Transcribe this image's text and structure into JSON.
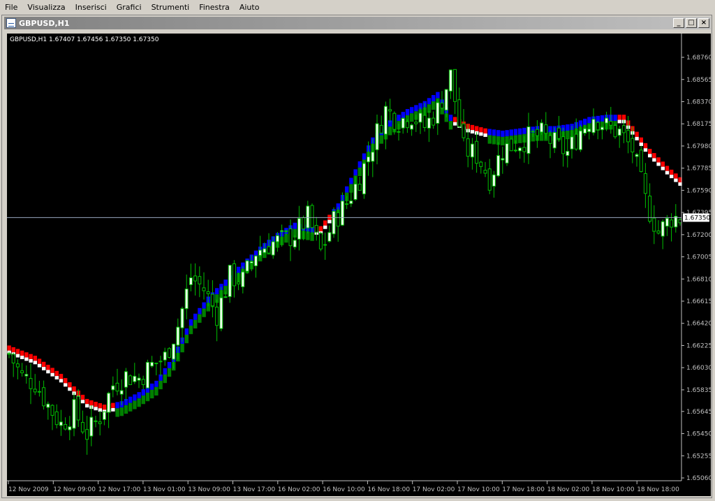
{
  "menu": [
    {
      "label": "File"
    },
    {
      "label": "Visualizza"
    },
    {
      "label": "Inserisci"
    },
    {
      "label": "Grafici"
    },
    {
      "label": "Strumenti"
    },
    {
      "label": "Finestra"
    },
    {
      "label": "Aiuto"
    }
  ],
  "window": {
    "title": "GBPUSD,H1",
    "minimize_glyph": "_",
    "maximize_glyph": "□",
    "close_glyph": "×"
  },
  "chart_info": "GBPUSD,H1  1.67407  1.67456  1.67350  1.67350",
  "colors": {
    "background": "#000000",
    "candle": "#00c000",
    "bull_body": "#eaffea",
    "bear_body": "#000000",
    "band_up": "#0000ff",
    "band_down": "#ff0000",
    "band_upper_edge": "#ffffff",
    "band_lower": "#008000",
    "price_line": "#9aa8c0"
  },
  "chart_data": {
    "type": "candlestick",
    "symbol": "GBPUSD",
    "timeframe": "H1",
    "current_price": "1.67350",
    "ylim": [
      1.6506,
      1.6892
    ],
    "y_ticks": [
      "1.68760",
      "1.68565",
      "1.68370",
      "1.68175",
      "1.67980",
      "1.67785",
      "1.67590",
      "1.67395",
      "1.67200",
      "1.67005",
      "1.66810",
      "1.66615",
      "1.66420",
      "1.66225",
      "1.66030",
      "1.65835",
      "1.65645",
      "1.65450",
      "1.65255",
      "1.65060"
    ],
    "x_ticks": [
      "12 Nov 2009",
      "12 Nov 09:00",
      "12 Nov 17:00",
      "13 Nov 01:00",
      "13 Nov 09:00",
      "13 Nov 17:00",
      "16 Nov 02:00",
      "16 Nov 10:00",
      "16 Nov 18:00",
      "17 Nov 02:00",
      "17 Nov 10:00",
      "17 Nov 18:00",
      "18 Nov 02:00",
      "18 Nov 10:00",
      "18 Nov 18:00"
    ],
    "close_anchors": [
      [
        0,
        1.6615
      ],
      [
        3,
        1.6595
      ],
      [
        6,
        1.659
      ],
      [
        9,
        1.657
      ],
      [
        12,
        1.6553
      ],
      [
        15,
        1.6565
      ],
      [
        18,
        1.6545
      ],
      [
        21,
        1.656
      ],
      [
        24,
        1.6588
      ],
      [
        27,
        1.6596
      ],
      [
        30,
        1.6594
      ],
      [
        33,
        1.6605
      ],
      [
        36,
        1.6612
      ],
      [
        39,
        1.664
      ],
      [
        42,
        1.6683
      ],
      [
        45,
        1.6672
      ],
      [
        48,
        1.665
      ],
      [
        51,
        1.6683
      ],
      [
        54,
        1.668
      ],
      [
        57,
        1.6705
      ],
      [
        60,
        1.6712
      ],
      [
        63,
        1.6715
      ],
      [
        66,
        1.672
      ],
      [
        69,
        1.6735
      ],
      [
        72,
        1.6705
      ],
      [
        75,
        1.6732
      ],
      [
        78,
        1.6748
      ],
      [
        81,
        1.677
      ],
      [
        84,
        1.68
      ],
      [
        87,
        1.683
      ],
      [
        90,
        1.682
      ],
      [
        93,
        1.6825
      ],
      [
        96,
        1.6815
      ],
      [
        99,
        1.683
      ],
      [
        102,
        1.686
      ],
      [
        105,
        1.6795
      ],
      [
        108,
        1.679
      ],
      [
        111,
        1.677
      ],
      [
        114,
        1.6795
      ],
      [
        117,
        1.68
      ],
      [
        120,
        1.6805
      ],
      [
        123,
        1.6808
      ],
      [
        126,
        1.68
      ],
      [
        129,
        1.6792
      ],
      [
        132,
        1.6812
      ],
      [
        135,
        1.6825
      ],
      [
        138,
        1.6815
      ],
      [
        141,
        1.681
      ],
      [
        144,
        1.6795
      ],
      [
        147,
        1.675
      ],
      [
        150,
        1.6722
      ],
      [
        153,
        1.6735
      ],
      [
        155,
        1.6735
      ]
    ],
    "band_anchors": [
      [
        0,
        1.6617
      ],
      [
        6,
        1.6608
      ],
      [
        12,
        1.6592
      ],
      [
        18,
        1.657
      ],
      [
        22,
        1.6565
      ],
      [
        26,
        1.6568
      ],
      [
        30,
        1.6576
      ],
      [
        34,
        1.6586
      ],
      [
        38,
        1.6608
      ],
      [
        42,
        1.664
      ],
      [
        46,
        1.666
      ],
      [
        50,
        1.6675
      ],
      [
        54,
        1.669
      ],
      [
        58,
        1.6704
      ],
      [
        62,
        1.6716
      ],
      [
        66,
        1.6725
      ],
      [
        70,
        1.6722
      ],
      [
        72,
        1.6722
      ],
      [
        76,
        1.6742
      ],
      [
        80,
        1.6772
      ],
      [
        84,
        1.68
      ],
      [
        88,
        1.6815
      ],
      [
        92,
        1.6825
      ],
      [
        96,
        1.6832
      ],
      [
        99,
        1.684
      ],
      [
        102,
        1.682
      ],
      [
        106,
        1.6812
      ],
      [
        110,
        1.6808
      ],
      [
        114,
        1.6806
      ],
      [
        118,
        1.6808
      ],
      [
        122,
        1.681
      ],
      [
        126,
        1.681
      ],
      [
        130,
        1.6812
      ],
      [
        134,
        1.6818
      ],
      [
        138,
        1.682
      ],
      [
        142,
        1.682
      ],
      [
        144,
        1.681
      ],
      [
        148,
        1.679
      ],
      [
        152,
        1.6775
      ],
      [
        155,
        1.6765
      ]
    ],
    "band_state_anchors": [
      [
        0,
        "down"
      ],
      [
        25,
        "up"
      ],
      [
        71,
        "down"
      ],
      [
        75,
        "up"
      ],
      [
        103,
        "down"
      ],
      [
        111,
        "up"
      ],
      [
        141,
        "down"
      ]
    ],
    "candles_count": 156
  }
}
